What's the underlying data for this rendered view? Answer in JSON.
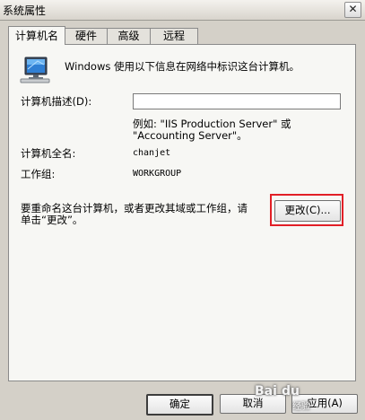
{
  "window": {
    "title": "系统属性",
    "close_glyph": "✕"
  },
  "tabs": [
    {
      "label": "计算机名",
      "active": true
    },
    {
      "label": "硬件",
      "active": false
    },
    {
      "label": "高级",
      "active": false
    },
    {
      "label": "远程",
      "active": false
    }
  ],
  "computer_name_tab": {
    "intro_text": "Windows 使用以下信息在网络中标识这台计算机。",
    "description_label": "计算机描述(D):",
    "description_value": "",
    "example_line1": "例如: \"IIS Production Server\" 或",
    "example_line2": "\"Accounting Server\"。",
    "full_name_label": "计算机全名:",
    "full_name_value": "chanjet",
    "workgroup_label": "工作组:",
    "workgroup_value": "WORKGROUP",
    "rename_hint_line1": "要重命名这台计算机，或者更改其域或工作组，请",
    "rename_hint_line2": "单击“更改”。",
    "change_button": "更改(C)...",
    "highlight_color": "#e21f26"
  },
  "footer": {
    "ok": "确定",
    "cancel": "取消",
    "apply": "应用(A)"
  },
  "watermark": {
    "brand": "Bai",
    "paw": "du",
    "sub": "经验"
  }
}
